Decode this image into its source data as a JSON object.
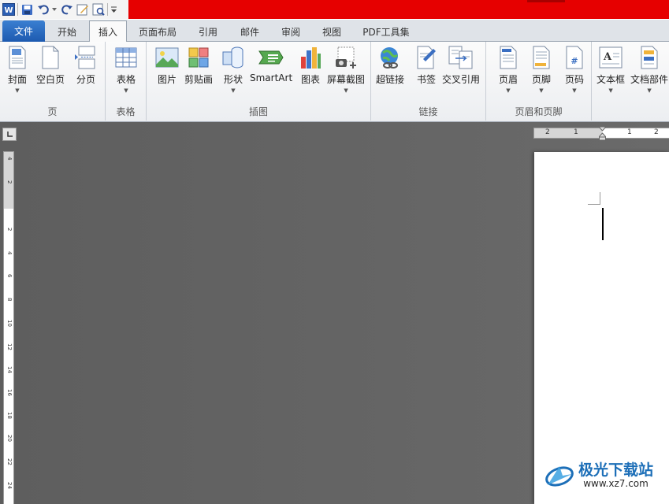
{
  "quick_access": {
    "icons": [
      "word-logo-icon",
      "save-icon",
      "undo-icon",
      "redo-icon",
      "edit-icon",
      "print-preview-icon",
      "customize-dropdown-icon"
    ]
  },
  "tabs": {
    "file": "文件",
    "home": "开始",
    "insert": "插入",
    "page_layout": "页面布局",
    "references": "引用",
    "mailings": "邮件",
    "review": "审阅",
    "view": "视图",
    "pdf_tools": "PDF工具集"
  },
  "active_tab": "插入",
  "ribbon": {
    "pages": {
      "label": "页",
      "cover": "封面",
      "blank_page": "空白页",
      "page_break": "分页"
    },
    "tables": {
      "label": "表格",
      "table": "表格"
    },
    "illustrations": {
      "label": "插图",
      "picture": "图片",
      "clip_art": "剪贴画",
      "shapes": "形状",
      "smartart": "SmartArt",
      "chart": "图表",
      "screenshot": "屏幕截图"
    },
    "links": {
      "label": "链接",
      "hyperlink": "超链接",
      "bookmark": "书签",
      "cross_reference": "交叉引用"
    },
    "header_footer": {
      "label": "页眉和页脚",
      "header": "页眉",
      "footer": "页脚",
      "page_number": "页码"
    },
    "text": {
      "text_box": "文本框",
      "quick_parts": "文档部件"
    }
  },
  "rulers": {
    "horizontal_numbers": [
      "2",
      "1",
      "1",
      "2"
    ],
    "vertical_numbers": [
      "4",
      "2",
      "2",
      "4",
      "6",
      "8",
      "10",
      "12",
      "14",
      "16",
      "18",
      "20",
      "22",
      "24"
    ]
  },
  "watermark": {
    "cn": "极光下载站",
    "en": "www.xz7.com"
  },
  "colors": {
    "title_bar_red": "#e60000",
    "file_tab_blue": "#1d5ab0",
    "workspace_gray": "#6b6b6b"
  }
}
